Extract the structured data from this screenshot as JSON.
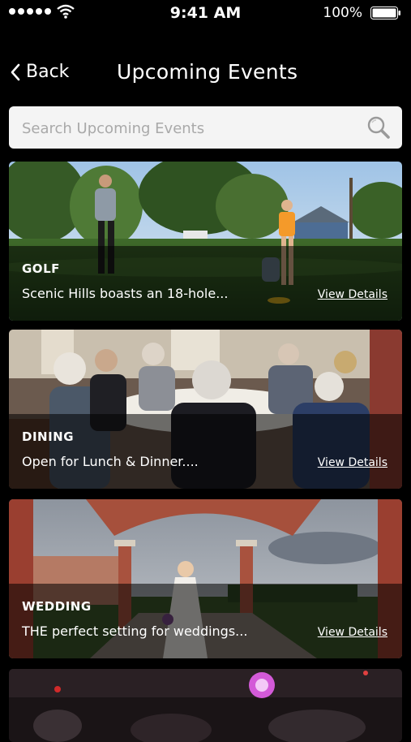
{
  "status_bar": {
    "time": "9:41 AM",
    "battery": "100%",
    "icons": [
      "signal-dots",
      "wifi-icon",
      "battery-icon"
    ]
  },
  "nav": {
    "back_label": "Back",
    "title": "Upcoming Events"
  },
  "search": {
    "placeholder": "Search Upcoming Events",
    "value": ""
  },
  "events": [
    {
      "category": "GOLF",
      "description": "Scenic Hills boasts an 18-hole...",
      "details_label": "View Details"
    },
    {
      "category": "DINING",
      "description": "Open for Lunch & Dinner....",
      "details_label": "View Details"
    },
    {
      "category": "WEDDING",
      "description": "THE perfect setting for weddings...",
      "details_label": "View Details"
    }
  ],
  "colors": {
    "background": "#000000",
    "search_bg": "#f4f4f4",
    "placeholder": "#a9a9a9",
    "text": "#ffffff"
  }
}
